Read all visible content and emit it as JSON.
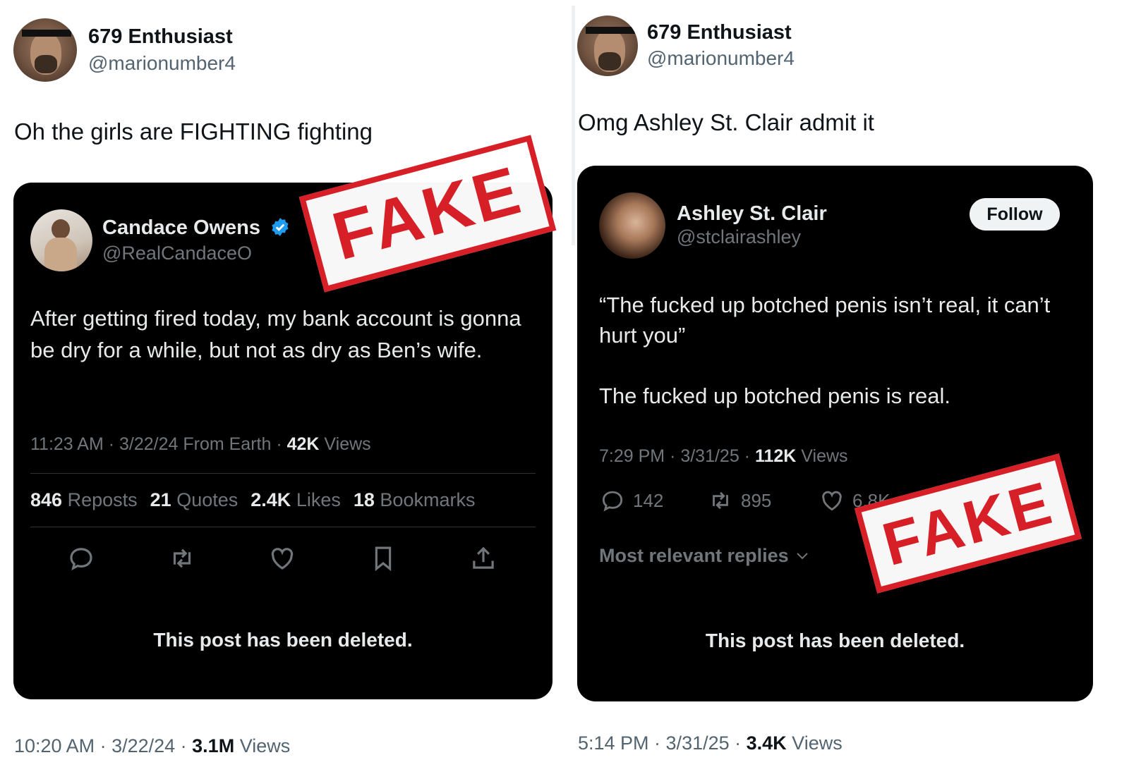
{
  "left": {
    "author": {
      "name": "679 Enthusiast",
      "handle": "@marionumber4"
    },
    "text": "Oh the girls are FIGHTING fighting",
    "embedded": {
      "name": "Candace Owens",
      "handle": "@RealCandaceO",
      "verified_icon": "verified-badge-icon",
      "text": "After getting fired today, my bank account is gonna be dry for a while, but not as dry as Ben’s wife.",
      "meta": {
        "time": "11:23 AM · 3/22/24 From Earth · ",
        "views_count": "42K",
        "views_label": " Views"
      },
      "stats": [
        {
          "count": "846",
          "label": "Reposts"
        },
        {
          "count": "21",
          "label": "Quotes"
        },
        {
          "count": "2.4K",
          "label": "Likes"
        },
        {
          "count": "18",
          "label": "Bookmarks"
        }
      ],
      "actions": [
        "reply-icon",
        "repost-icon",
        "like-icon",
        "bookmark-icon",
        "share-icon"
      ],
      "deleted_notice": "This post has been deleted."
    },
    "stamp": "FAKE",
    "meta": {
      "time": "10:20 AM · 3/22/24 · ",
      "views_count": "3.1M",
      "views_label": " Views"
    }
  },
  "right": {
    "author": {
      "name": "679 Enthusiast",
      "handle": "@marionumber4"
    },
    "text": "Omg Ashley St. Clair admit it",
    "embedded": {
      "name": "Ashley St. Clair",
      "handle": "@stclairashley",
      "follow_label": "Follow",
      "text_line1": "“The fucked up botched penis isn’t real, it can’t hurt you”",
      "text_line2": "The fucked up botched penis is real.",
      "meta": {
        "time": "7:29 PM · 3/31/25 · ",
        "views_count": "112K",
        "views_label": " Views"
      },
      "engagement": {
        "replies": "142",
        "reposts": "895",
        "likes": "6.8K"
      },
      "replies_sort": "Most relevant replies",
      "deleted_notice": "This post has been deleted."
    },
    "stamp": "FAKE",
    "meta": {
      "time": "5:14 PM · 3/31/25 · ",
      "views_count": "3.4K",
      "views_label": " Views"
    }
  },
  "colors": {
    "fake_red": "#d61f26",
    "card_bg": "#000000",
    "verified_blue": "#1d9bf0"
  }
}
